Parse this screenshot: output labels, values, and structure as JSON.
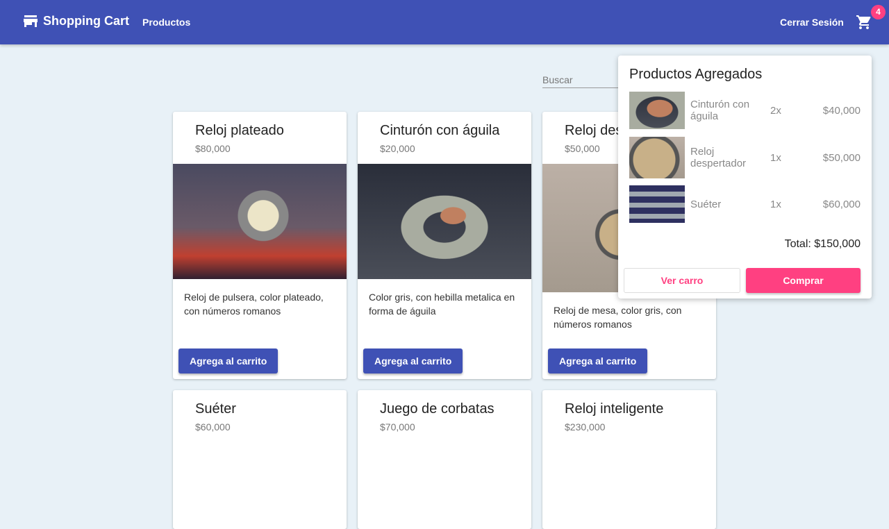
{
  "header": {
    "brand": "Shopping Cart",
    "nav": "Productos",
    "logout": "Cerrar Sesión",
    "cart_count": "4"
  },
  "search": {
    "placeholder": "Buscar"
  },
  "products": [
    {
      "name": "Reloj plateado",
      "price": "$80,000",
      "desc": "Reloj de pulsera, color plateado, con números romanos",
      "button": "Agrega al carrito"
    },
    {
      "name": "Cinturón con águila",
      "price": "$20,000",
      "desc": "Color gris, con hebilla metalica en forma de águila",
      "button": "Agrega al carrito"
    },
    {
      "name": "Reloj despertador",
      "price": "$50,000",
      "desc": "Reloj de mesa, color gris, con números romanos",
      "button": "Agrega al carrito"
    },
    {
      "name": "Suéter",
      "price": "$60,000"
    },
    {
      "name": "Juego de corbatas",
      "price": "$70,000"
    },
    {
      "name": "Reloj inteligente",
      "price": "$230,000"
    }
  ],
  "cart": {
    "title": "Productos Agregados",
    "items": [
      {
        "name": "Cinturón con águila",
        "qty": "2x",
        "price": "$40,000"
      },
      {
        "name": "Reloj despertador",
        "qty": "1x",
        "price": "$50,000"
      },
      {
        "name": "Suéter",
        "qty": "1x",
        "price": "$60,000"
      }
    ],
    "total": "Total: $150,000",
    "view": "Ver carro",
    "buy": "Comprar"
  },
  "colors": {
    "primary": "#3f51b5",
    "accent": "#ff4081",
    "background": "#e8f1f7"
  }
}
